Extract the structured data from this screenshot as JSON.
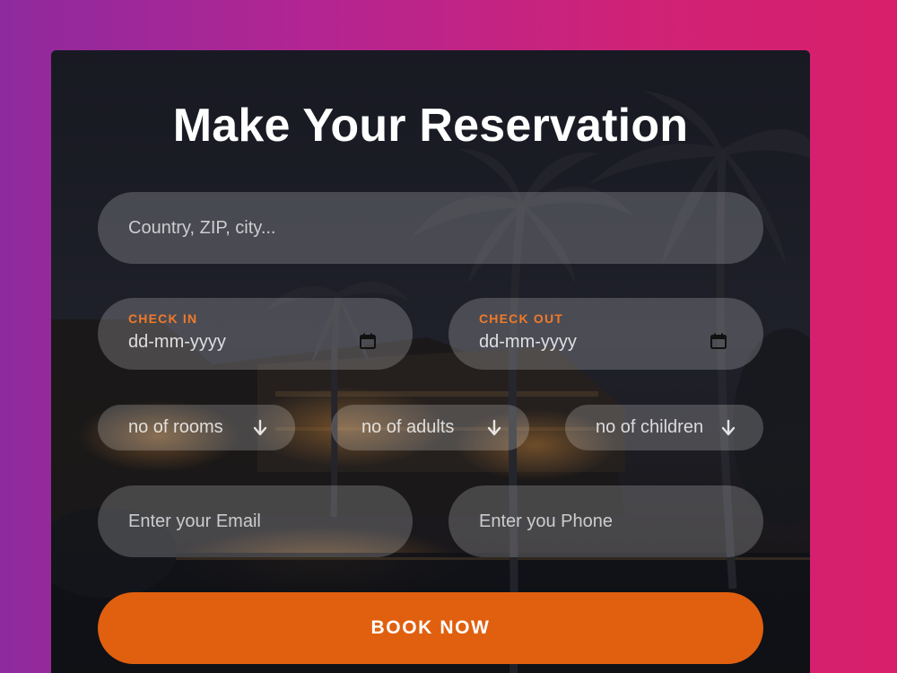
{
  "form": {
    "title": "Make Your Reservation",
    "location_placeholder": "Country, ZIP, city...",
    "check_in": {
      "label": "CHECK IN",
      "value": "dd-mm-yyyy",
      "icon": "calendar-icon"
    },
    "check_out": {
      "label": "CHECK OUT",
      "value": "dd-mm-yyyy",
      "icon": "calendar-icon"
    },
    "selects": {
      "rooms": "no of rooms",
      "adults": "no of adults",
      "children": "no of children",
      "icon": "arrow-down-icon"
    },
    "email_placeholder": "Enter your Email",
    "phone_placeholder": "Enter you Phone",
    "submit_label": "BOOK NOW"
  },
  "colors": {
    "accent": "#e0600f",
    "label_accent": "#f07a2a",
    "background_start": "#8e2a9e",
    "background_end": "#d81f6b"
  }
}
